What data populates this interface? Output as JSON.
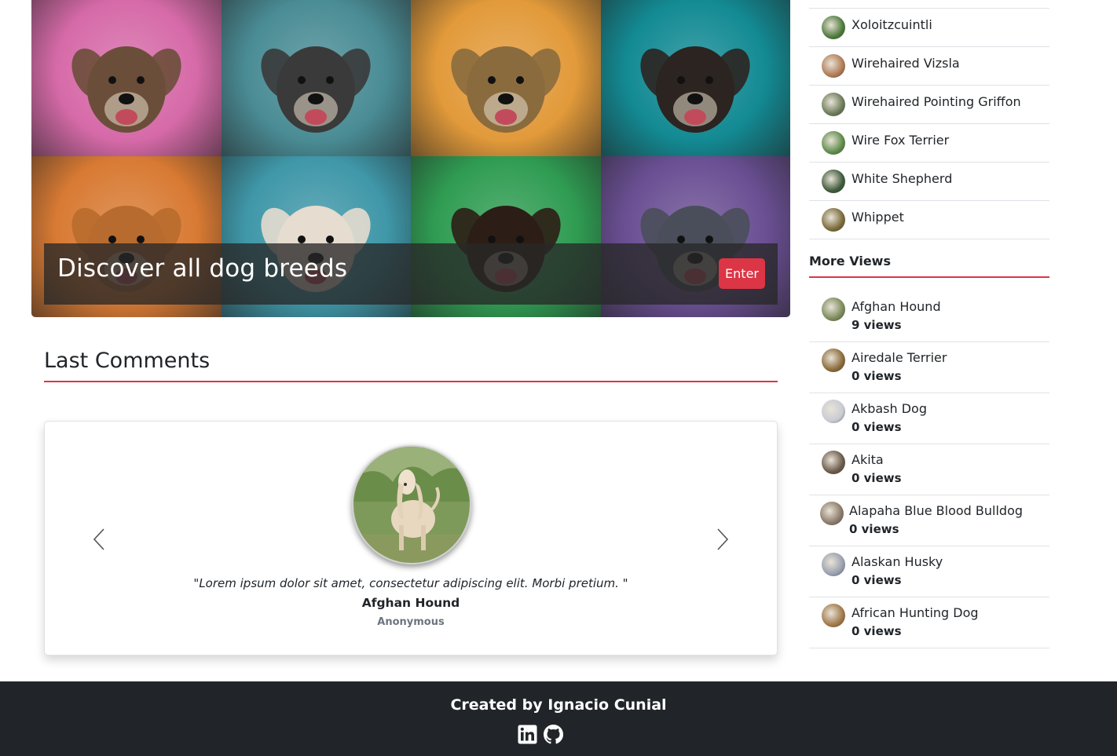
{
  "hero": {
    "title": "Discover all dog breeds",
    "enter_label": "Enter",
    "tile_backgrounds": [
      "#d66aa8",
      "#4a8c95",
      "#e29a3a",
      "#138a93",
      "#d87a33",
      "#3f97a8",
      "#2f9c52",
      "#6a4f93"
    ],
    "tile_dogs": [
      "#6b4e3a",
      "#3a3a3a",
      "#8a6b3e",
      "#2b2420",
      "#b86b2e",
      "#e6dccf",
      "#2c1e16",
      "#4a4e5a"
    ]
  },
  "comments": {
    "section_title": "Last Comments",
    "items": [
      {
        "quote": "\"Lorem ipsum dolor sit amet, consectetur adipiscing elit. Morbi pretium. \"",
        "breed": "Afghan Hound",
        "author": "Anonymous"
      }
    ],
    "prev_icon": "chevron-left-icon",
    "next_icon": "chevron-right-icon"
  },
  "sidebar": {
    "breeds": [
      {
        "name": "Xoloitzcuintli",
        "color": "#4d7a3c"
      },
      {
        "name": "Wirehaired Vizsla",
        "color": "#b07a55"
      },
      {
        "name": "Wirehaired Pointing Griffon",
        "color": "#6b7a58"
      },
      {
        "name": "Wire Fox Terrier",
        "color": "#5e8b4a"
      },
      {
        "name": "White Shepherd",
        "color": "#3d5a3a"
      },
      {
        "name": "Whippet",
        "color": "#7a6a3a"
      }
    ],
    "views_title": "More Views",
    "views": [
      {
        "name": "Afghan Hound",
        "count": "9 views",
        "color": "#7a8a5a"
      },
      {
        "name": "Airedale Terrier",
        "count": "0 views",
        "color": "#8a6a3a"
      },
      {
        "name": "Akbash Dog",
        "count": "0 views",
        "color": "#c9cbd4"
      },
      {
        "name": "Akita",
        "count": "0 views",
        "color": "#6a5a4a"
      },
      {
        "name": "Alapaha Blue Blood Bulldog",
        "count": "0 views",
        "color": "#8a7a6a"
      },
      {
        "name": "Alaskan Husky",
        "count": "0 views",
        "color": "#9aa0b0"
      },
      {
        "name": "African Hunting Dog",
        "count": "0 views",
        "color": "#a0784a"
      }
    ]
  },
  "footer": {
    "credit": "Created by Ignacio Cunial",
    "icons": [
      "linkedin-icon",
      "github-icon"
    ]
  },
  "colors": {
    "accent": "#dc3545",
    "footer_bg": "#212529",
    "text": "#212529",
    "muted": "#6c757d"
  }
}
